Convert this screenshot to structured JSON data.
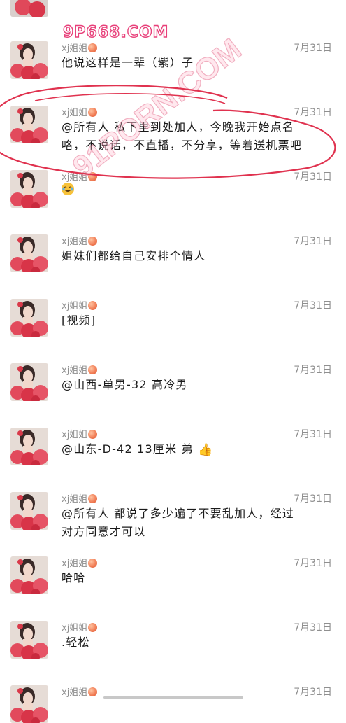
{
  "watermarks": {
    "site_top": "9P668.COM",
    "site_diagonal": "91PORN.COM"
  },
  "colors": {
    "circle_annotation": "#e0324f",
    "name_gray": "#8f8f8f",
    "text_dark": "#1a1a1a",
    "watermark_pink": "#e8407a"
  },
  "messages": [
    {
      "name": "xj姐姐",
      "time": "7月31日",
      "lines": [
        "他说这样是一辈（紫）子"
      ]
    },
    {
      "name": "xj姐姐",
      "time": "7月31日",
      "lines": [
        "@所有人 私下里到处加人，今晚我开始点名",
        "咯，不说话，不直播，不分享，等着送机票吧"
      ]
    },
    {
      "name": "xj姐姐",
      "time": "7月31日",
      "lines": [
        ""
      ],
      "emoji": "laughing-crying-face-icon"
    },
    {
      "name": "xj姐姐",
      "time": "7月31日",
      "lines": [
        "姐妹们都给自己安排个情人"
      ]
    },
    {
      "name": "xj姐姐",
      "time": "7月31日",
      "lines": [
        "[视频]"
      ]
    },
    {
      "name": "xj姐姐",
      "time": "7月31日",
      "lines": [
        "@山西-单男-32 高冷男"
      ]
    },
    {
      "name": "xj姐姐",
      "time": "7月31日",
      "lines": [
        "@山东-D-42  13厘米 弟 "
      ],
      "emoji": "thumbs-up-icon"
    },
    {
      "name": "xj姐姐",
      "time": "7月31日",
      "lines": [
        "@所有人 都说了多少遍了不要乱加人，经过",
        "对方同意才可以"
      ]
    },
    {
      "name": "xj姐姐",
      "time": "7月31日",
      "lines": [
        "哈哈"
      ]
    },
    {
      "name": "xj姐姐",
      "time": "7月31日",
      "lines": [
        ".轻松"
      ]
    },
    {
      "name": "xj姐姐",
      "time": "7月31日",
      "lines": []
    }
  ]
}
